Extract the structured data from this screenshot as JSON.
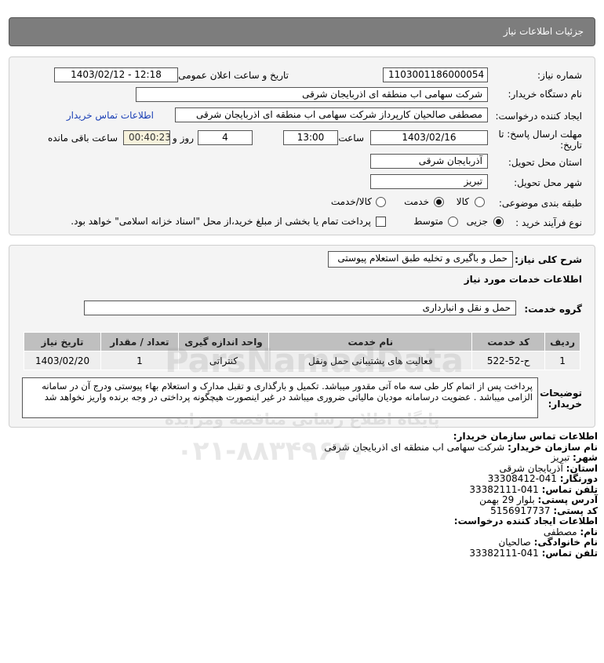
{
  "title": "جزئيات اطلاعات نیاز",
  "form": {
    "need_number_label": "شماره نیاز:",
    "need_number": "1103001186000054",
    "announce_label": "تاریخ و ساعت اعلان عمومی:",
    "announce_value": "1403/02/12 - 12:18",
    "buyer_org_label": "نام دستگاه خریدار:",
    "buyer_org": "شرکت سهامی اب منطقه ای اذربایجان شرقی",
    "creator_label": "ایجاد کننده درخواست:",
    "creator": "مصطفی صالحیان کارپرداز شرکت سهامی اب منطقه ای اذربایجان شرقی",
    "contact_link": "اطلاعات تماس خریدار",
    "deadline_label_1": "مهلت ارسال پاسخ: تا",
    "deadline_label_2": "تاریخ:",
    "deadline_date": "1403/02/16",
    "time_label": "ساعت",
    "deadline_time": "13:00",
    "days_value": "4",
    "days_label": "روز و",
    "remaining_time": "00:40:23",
    "remaining_label": "ساعت باقی مانده",
    "province_label": "استان محل تحویل:",
    "province": "آذربایجان شرقی",
    "city_label": "شهر محل تحویل:",
    "city": "تبریز",
    "category_label": "طبقه بندی موضوعی:",
    "category_options": [
      "کالا",
      "خدمت",
      "کالا/خدمت"
    ],
    "category_selected": "خدمت",
    "process_label": "نوع فرآیند خرید :",
    "process_options": [
      "جزیی",
      "متوسط"
    ],
    "process_selected": "جزیی",
    "payment_checkbox_text": "پرداخت تمام یا بخشی از مبلغ خرید،از محل \"اسناد خزانه اسلامی\" خواهد بود.",
    "payment_checked": false
  },
  "general": {
    "desc_label": "شرح کلی نیاز:",
    "desc_value": "حمل و باگیری و تخلیه طبق استعلام پیوستی",
    "services_heading": "اطلاعات خدمات مورد نیاز",
    "service_group_label": "گروه خدمت:",
    "service_group": "حمل و نقل و انبارداری",
    "table": {
      "headers": [
        "ردیف",
        "کد خدمت",
        "نام خدمت",
        "واحد اندازه گیری",
        "تعداد / مقدار",
        "تاریخ نیاز"
      ],
      "rows": [
        [
          "1",
          "ح-52-522",
          "فعالیت های پشتیبانی حمل ونقل",
          "کنتراتی",
          "1",
          "1403/02/20"
        ]
      ]
    },
    "buyer_notes_label_1": "توضیحات",
    "buyer_notes_label_2": "خریدار:",
    "buyer_notes": "پرداخت پس از اتمام کار طی سه ماه آتی مقدور میباشد. تکمیل و بارگذاری و تقبل مدارک و استعلام بهاء پیوستی ودرج آن در سامانه الزامی میباشد . عضویت درسامانه مودیان مالیاتی ضروری میباشد در غیر اینصورت هیچگونه پرداختی در وجه برنده واریز نخواهد شد"
  },
  "contact": {
    "heading": "اطلاعات تماس سازمان خریدار:",
    "org_label": "نام سازمان خریدار:",
    "org": "شرکت سهامی اب منطقه ای اذربایجان شرقی",
    "city_label": "شهر:",
    "city": "تبریز",
    "province_label": "استان:",
    "province": "آذربایجان شرقی",
    "fax_label": "دورنگار:",
    "fax": "041-33308412",
    "phone_label": "تلفن تماس:",
    "phone": "041-33382111",
    "address_label": "آدرس پستی:",
    "address": "بلوار 29 بهمن",
    "postal_label": "کد پستی:",
    "postal": "5156917737",
    "creator_heading": "اطلاعات ایجاد کننده درخواست:",
    "name_label": "نام:",
    "name": "مصطفی",
    "family_label": "نام خانوادگی:",
    "family": "صالحیان",
    "creator_phone_label": "تلفن تماس:",
    "creator_phone": "041-33382111"
  },
  "watermark": {
    "line1": "ParsNamadData",
    "line2": "پایگاه اطلاع رسانی مناقصه ومزایده",
    "line3": "۰۲۱-۸۸۳۴۹۶۷۰"
  }
}
